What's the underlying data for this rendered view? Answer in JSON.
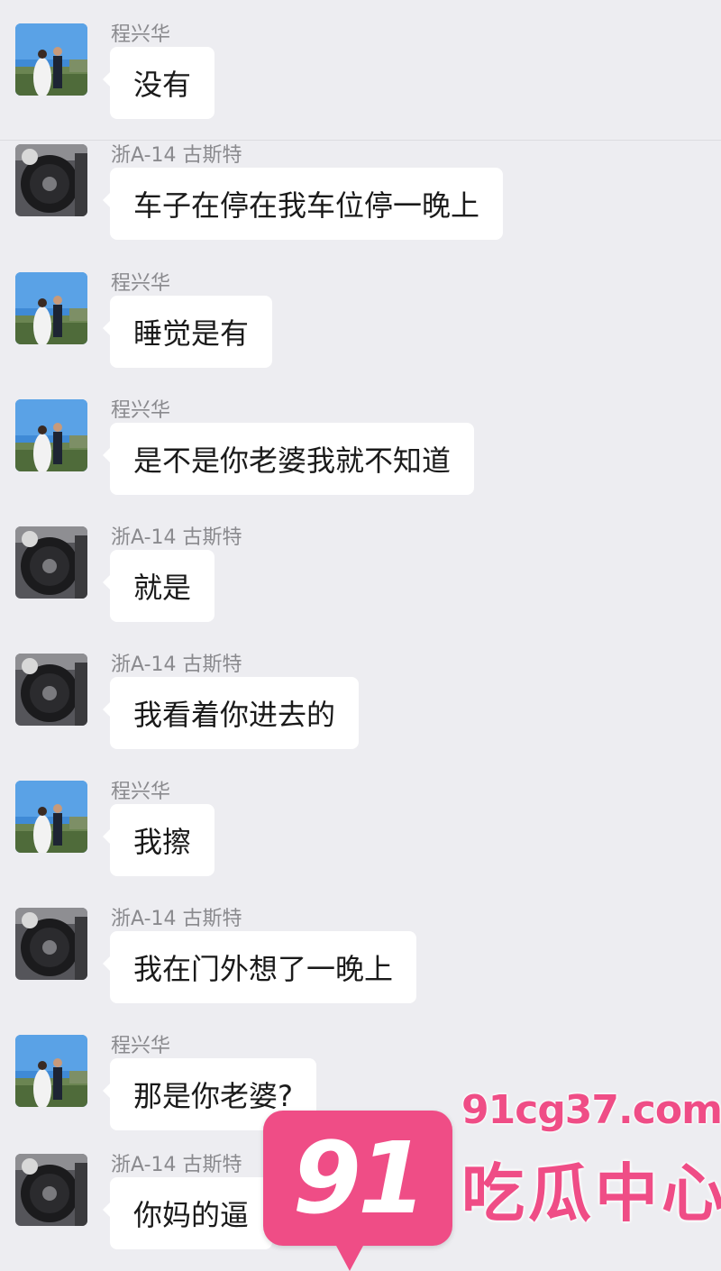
{
  "messages": [
    {
      "sender": "程兴华",
      "avatar": "couple-photo-avatar",
      "text": "没有"
    },
    {
      "sender": "浙A-14 古斯特",
      "avatar": "car-wheel-avatar",
      "text": "车子在停在我车位停一晚上"
    },
    {
      "sender": "程兴华",
      "avatar": "couple-photo-avatar",
      "text": "睡觉是有"
    },
    {
      "sender": "程兴华",
      "avatar": "couple-photo-avatar",
      "text": "是不是你老婆我就不知道"
    },
    {
      "sender": "浙A-14 古斯特",
      "avatar": "car-wheel-avatar",
      "text": "就是"
    },
    {
      "sender": "浙A-14 古斯特",
      "avatar": "car-wheel-avatar",
      "text": "我看着你进去的"
    },
    {
      "sender": "程兴华",
      "avatar": "couple-photo-avatar",
      "text": "我擦"
    },
    {
      "sender": "浙A-14 古斯特",
      "avatar": "car-wheel-avatar",
      "text": "我在门外想了一晚上"
    },
    {
      "sender": "程兴华",
      "avatar": "couple-photo-avatar",
      "text": "那是你老婆?"
    },
    {
      "sender": "浙A-14 古斯特",
      "avatar": "car-wheel-avatar",
      "text": "你妈的逼"
    }
  ],
  "watermark": {
    "number": "91",
    "url": "91cg37.com",
    "text": "吃瓜中心"
  },
  "colors": {
    "background": "#ededf1",
    "bubble": "#ffffff",
    "sender_name": "#8a8a8e",
    "watermark_pink": "#ef4d86"
  }
}
